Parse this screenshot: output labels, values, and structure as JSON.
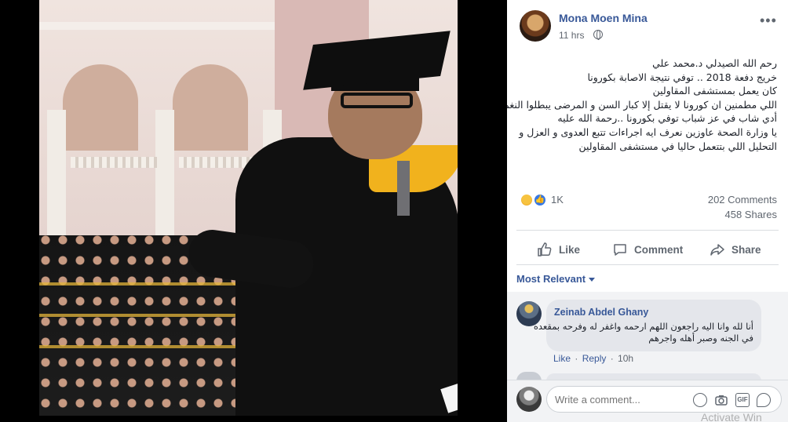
{
  "post": {
    "author": "Mona Moen Mina",
    "time": "11 hrs",
    "privacy_icon": "globe-icon",
    "more_label": "•••",
    "text_lines": [
      "رحم الله الصيدلي د.محمد علي",
      "خريج دفعة 2018 .. توفي نتيجة الاصابة بكورونا",
      "كان يعمل بمستشفى المقاولين",
      "اللي مطمنين ان كورونا لا يقتل إلا كبار السن و المرضى يبطلوا النغمة دي",
      "أدي شاب في عز شباب توفي بكورونا ..رحمة الله عليه",
      "يا وزارة الصحة عاوزين نعرف ايه اجراءات تتبع العدوى و العزل و",
      "التحليل اللي بتتعمل حاليا في مستشفى المقاولين"
    ],
    "reactions_count": "1K",
    "comments_count": "202 Comments",
    "shares_count": "458 Shares"
  },
  "actions": {
    "like": "Like",
    "comment": "Comment",
    "share": "Share"
  },
  "comments": {
    "sort_label": "Most Relevant",
    "items": [
      {
        "author": "Zeinab Abdel Ghany",
        "text_lines": [
          "أنا لله وانا اليه راجعون اللهم ارحمه واغفر له وفرحه بمقعده",
          "في الجنه وصبر أهله واجرهم"
        ],
        "like_label": "Like",
        "reply_label": "Reply",
        "time": "10h"
      }
    ],
    "write_placeholder": "Write a comment...",
    "gif_label": "GIF"
  },
  "watermark": "Activate Win"
}
